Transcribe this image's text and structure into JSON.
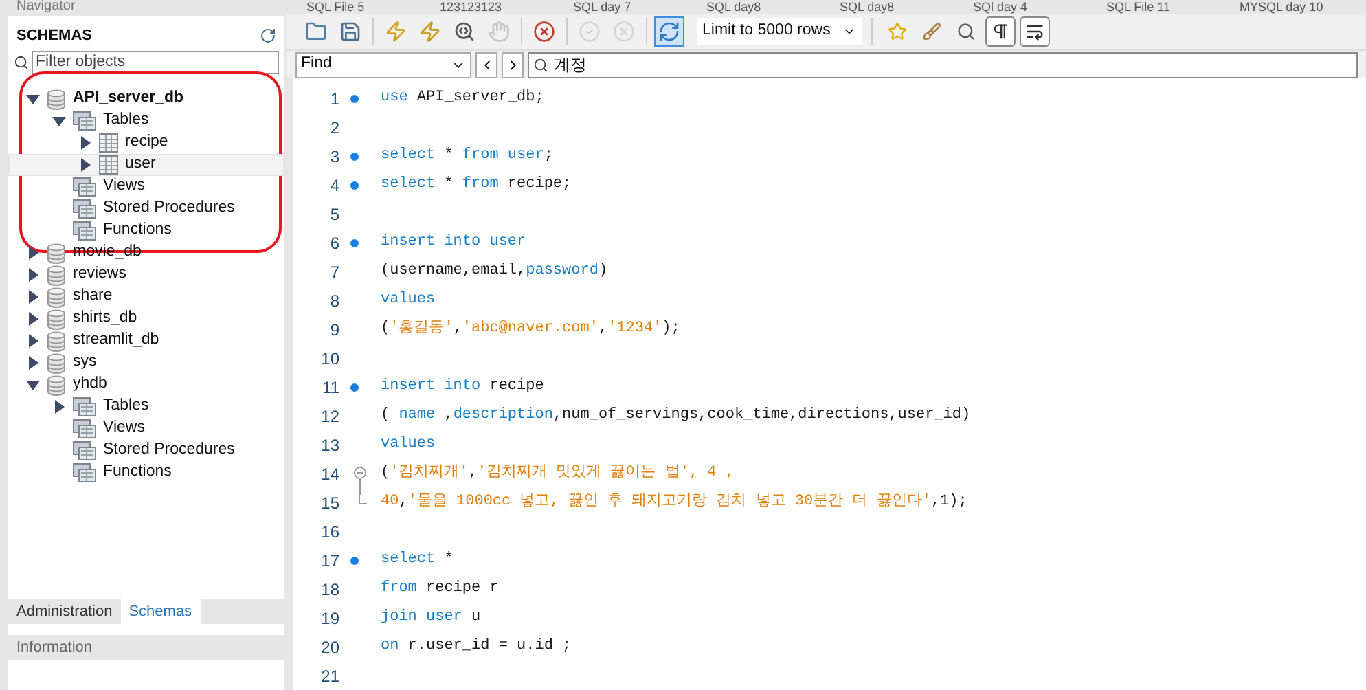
{
  "navigator": {
    "title": "Navigator",
    "schemas_title": "SCHEMAS",
    "filter": {
      "placeholder": "Filter objects"
    },
    "tree": [
      {
        "label": "API_server_db",
        "kind": "schema",
        "expanded": true,
        "default": true,
        "circled": true,
        "selected": false,
        "children": [
          {
            "label": "Tables",
            "kind": "folder",
            "expanded": true,
            "selected": false,
            "children": [
              {
                "label": "recipe",
                "kind": "table",
                "expanded": false,
                "selected": false
              },
              {
                "label": "user",
                "kind": "table",
                "expanded": false,
                "selected": true
              }
            ]
          },
          {
            "label": "Views",
            "kind": "folder",
            "selected": false
          },
          {
            "label": "Stored Procedures",
            "kind": "folder",
            "selected": false
          },
          {
            "label": "Functions",
            "kind": "folder",
            "selected": false
          }
        ]
      },
      {
        "label": "movie_db",
        "kind": "schema",
        "expanded": false,
        "default": false,
        "circled": false,
        "selected": false
      },
      {
        "label": "reviews",
        "kind": "schema",
        "expanded": false,
        "default": false,
        "circled": false,
        "selected": false
      },
      {
        "label": "share",
        "kind": "schema",
        "expanded": false,
        "default": false,
        "circled": false,
        "selected": false
      },
      {
        "label": "shirts_db",
        "kind": "schema",
        "expanded": false,
        "default": false,
        "circled": false,
        "selected": false
      },
      {
        "label": "streamlit_db",
        "kind": "schema",
        "expanded": false,
        "default": false,
        "circled": false,
        "selected": false
      },
      {
        "label": "sys",
        "kind": "schema",
        "expanded": false,
        "default": false,
        "circled": false,
        "selected": false
      },
      {
        "label": "yhdb",
        "kind": "schema",
        "expanded": true,
        "default": false,
        "circled": false,
        "selected": false,
        "children": [
          {
            "label": "Tables",
            "kind": "folder",
            "expanded": false,
            "selected": false
          },
          {
            "label": "Views",
            "kind": "folder",
            "selected": false
          },
          {
            "label": "Stored Procedures",
            "kind": "folder",
            "selected": false
          },
          {
            "label": "Functions",
            "kind": "folder",
            "selected": false
          }
        ]
      }
    ],
    "bottom_tabs": [
      {
        "label": "Administration",
        "selected": false
      },
      {
        "label": "Schemas",
        "selected": true
      }
    ],
    "information_title": "Information"
  },
  "editor_tabs": [
    {
      "label": "SQL File 5"
    },
    {
      "label": "123123123"
    },
    {
      "label": "SQL day 7"
    },
    {
      "label": "SQL day8"
    },
    {
      "label": "SQL day8"
    },
    {
      "label": "SQl day 4"
    },
    {
      "label": "SQL File 11"
    },
    {
      "label": "MYSQL day 10"
    }
  ],
  "toolbar": {
    "buttons": [
      {
        "disabled": false,
        "selected": false
      },
      {
        "disabled": false,
        "selected": false
      },
      {
        "disabled": false,
        "selected": false
      },
      {
        "disabled": false,
        "selected": false
      },
      {
        "disabled": false,
        "selected": false
      },
      {
        "disabled": true,
        "selected": false
      },
      {
        "disabled": false,
        "selected": false
      },
      {
        "disabled": true,
        "selected": false
      },
      {
        "disabled": true,
        "selected": false
      },
      {
        "disabled": false,
        "selected": true
      }
    ],
    "limit": "Limit to 5000 rows",
    "buttons_right": [
      {
        "disabled": false
      },
      {
        "disabled": false
      },
      {
        "disabled": false
      },
      {
        "disabled": false
      },
      {
        "disabled": false
      }
    ]
  },
  "find_bar": {
    "mode": "Find",
    "value": "계정"
  },
  "editor": {
    "lines": [
      {
        "number": "1",
        "statement": true,
        "tokens": [
          {
            "t": "use",
            "kind": "kw"
          },
          {
            "t": " API_server_db;",
            "kind": "id"
          }
        ]
      },
      {
        "number": "2",
        "statement": false
      },
      {
        "number": "3",
        "statement": true,
        "tokens": [
          {
            "t": "select",
            "kind": "kw"
          },
          {
            "t": " * ",
            "kind": "id"
          },
          {
            "t": "from user",
            "kind": "kw"
          },
          {
            "t": ";",
            "kind": "id"
          }
        ]
      },
      {
        "number": "4",
        "statement": true,
        "tokens": [
          {
            "t": "select",
            "kind": "kw"
          },
          {
            "t": " * ",
            "kind": "id"
          },
          {
            "t": "from",
            "kind": "kw"
          },
          {
            "t": " recipe;",
            "kind": "id"
          }
        ]
      },
      {
        "number": "5",
        "statement": false
      },
      {
        "number": "6",
        "statement": true,
        "tokens": [
          {
            "t": "insert into user",
            "kind": "kw"
          }
        ]
      },
      {
        "number": "7",
        "statement": false,
        "tokens": [
          {
            "t": "(username,email,",
            "kind": "id"
          },
          {
            "t": "password",
            "kind": "kw"
          },
          {
            "t": ")",
            "kind": "id"
          }
        ]
      },
      {
        "number": "8",
        "statement": false,
        "tokens": [
          {
            "t": "values",
            "kind": "kw"
          }
        ]
      },
      {
        "number": "9",
        "statement": false,
        "tokens": [
          {
            "t": "(",
            "kind": "id"
          },
          {
            "t": "'홍길동'",
            "kind": "str"
          },
          {
            "t": ",",
            "kind": "id"
          },
          {
            "t": "'abc@naver.com'",
            "kind": "str"
          },
          {
            "t": ",",
            "kind": "id"
          },
          {
            "t": "'1234'",
            "kind": "str"
          },
          {
            "t": ");",
            "kind": "id"
          }
        ]
      },
      {
        "number": "10",
        "statement": false
      },
      {
        "number": "11",
        "statement": true,
        "tokens": [
          {
            "t": "insert into",
            "kind": "kw"
          },
          {
            "t": " recipe",
            "kind": "id"
          }
        ]
      },
      {
        "number": "12",
        "statement": false,
        "tokens": [
          {
            "t": "( ",
            "kind": "id"
          },
          {
            "t": "name",
            "kind": "kw"
          },
          {
            "t": " ,",
            "kind": "id"
          },
          {
            "t": "description",
            "kind": "kw"
          },
          {
            "t": ",num_of_servings,cook_time,directions,user_id)",
            "kind": "id"
          }
        ]
      },
      {
        "number": "13",
        "statement": false,
        "tokens": [
          {
            "t": "values",
            "kind": "kw"
          }
        ]
      },
      {
        "number": "14",
        "statement": false,
        "fold_start": true,
        "tokens": [
          {
            "t": "(",
            "kind": "id"
          },
          {
            "t": "'김치찌개'",
            "kind": "str"
          },
          {
            "t": ",",
            "kind": "id"
          },
          {
            "t": "'김치찌개 맛있게 끓이는 법'",
            "kind": "str"
          },
          {
            "t": ", 4 ,",
            "kind": "num"
          }
        ]
      },
      {
        "number": "15",
        "statement": false,
        "fold_end": true,
        "tokens": [
          {
            "t": "40",
            "kind": "num"
          },
          {
            "t": ",",
            "kind": "id"
          },
          {
            "t": "'물을 1000cc 넣고, 끓인 후 돼지고기랑 김치 넣고 30분간 더 끓인다'",
            "kind": "str"
          },
          {
            "t": ",1);",
            "kind": "id"
          }
        ]
      },
      {
        "number": "16",
        "statement": false
      },
      {
        "number": "17",
        "statement": true,
        "tokens": [
          {
            "t": "select",
            "kind": "kw"
          },
          {
            "t": " *",
            "kind": "id"
          }
        ]
      },
      {
        "number": "18",
        "statement": false,
        "tokens": [
          {
            "t": "from",
            "kind": "kw"
          },
          {
            "t": " recipe r",
            "kind": "id"
          }
        ]
      },
      {
        "number": "19",
        "statement": false,
        "tokens": [
          {
            "t": "join user",
            "kind": "kw"
          },
          {
            "t": " u",
            "kind": "id"
          }
        ]
      },
      {
        "number": "20",
        "statement": false,
        "tokens": [
          {
            "t": "on",
            "kind": "kw"
          },
          {
            "t": " r.user_id = u.id ;",
            "kind": "id"
          }
        ]
      },
      {
        "number": "21",
        "statement": false
      }
    ]
  }
}
